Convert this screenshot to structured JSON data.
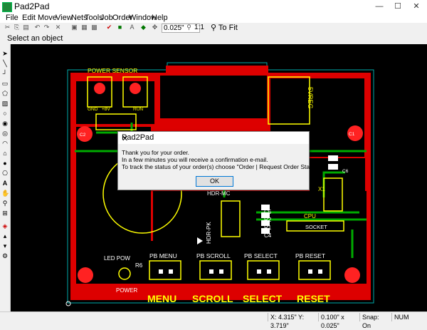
{
  "window": {
    "title": "Pad2Pad",
    "minimize": "—",
    "maximize": "☐",
    "close": "✕"
  },
  "menu": [
    "File",
    "Edit",
    "Move",
    "View",
    "Nets",
    "Tools",
    "Job",
    "Order",
    "Window",
    "Help"
  ],
  "toolbar": {
    "zoom_value": "0.025\"",
    "ratio_label": "1:1",
    "fit_label": "To Fit"
  },
  "status_hint": "Select an object",
  "statusbar": {
    "coords": "X: 4.315\"  Y: 3.719\"",
    "grid": "0.100\" x 0.025\"",
    "snap": "Snap: On",
    "num": "NUM"
  },
  "dialog": {
    "title": "Pad2Pad",
    "close": "✕",
    "line1": "Thank you for your order.",
    "line2": "In a few minutes you will receive a confirmation e-mail.",
    "line3": "To track the status of your order(s) choose \"Order | Request Order Status\".",
    "ok": "OK"
  },
  "board": {
    "power_sensor": "POWER  SENSOR",
    "gnd": "GND",
    "plus8v": "+8V",
    "run": "RUN",
    "c2": "C2",
    "vreg": "5VREG",
    "c1": "C1",
    "c6": "C6",
    "x1": "X1",
    "hdr_mc": "HDR-MC",
    "hdr_pk": "HDR-PK",
    "c5": "C5",
    "r2": "R2",
    "r1": "R1",
    "c4": "C4",
    "cpu": "CPU",
    "socket": "SOCKET",
    "led_pow": "LED POW",
    "r6": "R6",
    "power": "POWER",
    "pb_menu": "PB MENU",
    "pb_scroll": "PB SCROLL",
    "pb_select": "PB SELECT",
    "pb_reset": "PB RESET",
    "menu": "MENU",
    "scroll": "SCROLL",
    "select": "SELECT",
    "reset": "RESET"
  },
  "colors": {
    "board": "#dd0000",
    "trace_green": "#00aa00",
    "silk_yellow": "#ffff00",
    "outline_cyan": "#00aaaa",
    "pad_white": "#ffffff"
  }
}
